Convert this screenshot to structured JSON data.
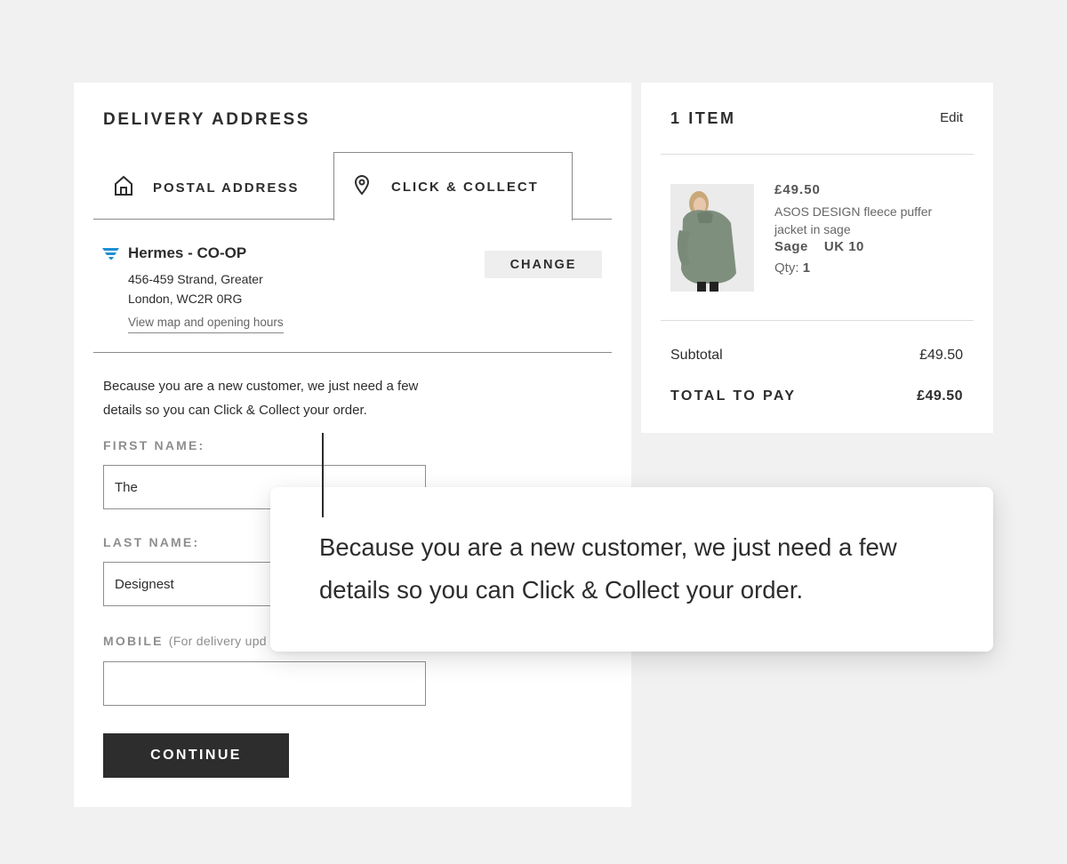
{
  "delivery": {
    "title": "DELIVERY ADDRESS",
    "tabs": {
      "postal": "POSTAL ADDRESS",
      "collect": "CLICK & COLLECT"
    },
    "store": {
      "name": "Hermes - CO-OP",
      "address_line1": "456-459 Strand, Greater",
      "address_line2": "London, WC2R 0RG",
      "map_link": "View map and opening hours",
      "change_label": "CHANGE"
    },
    "intro_line1": "Because you are a new customer, we just need a few",
    "intro_line2": "details so you can Click & Collect your order.",
    "first_name": {
      "label": "FIRST NAME:",
      "value": "The"
    },
    "last_name": {
      "label": "LAST NAME:",
      "value": "Designest"
    },
    "mobile": {
      "label": "MOBILE",
      "note": "(For delivery upd",
      "value": ""
    },
    "continue_label": "CONTINUE"
  },
  "basket": {
    "title": "1 ITEM",
    "edit_label": "Edit",
    "item": {
      "price": "£49.50",
      "name_line1": "ASOS DESIGN fleece puffer",
      "name_line2": "jacket in sage",
      "colour": "Sage",
      "size": "UK 10",
      "qty_label": "Qty:",
      "qty_value": "1"
    },
    "subtotal_label": "Subtotal",
    "subtotal_value": "£49.50",
    "total_label": "TOTAL TO PAY",
    "total_value": "£49.50"
  },
  "callout": {
    "line1": "Because you are a new customer, we just need a few",
    "line2": "details so you can Click & Collect your order."
  },
  "colors": {
    "accent_dark": "#2d2d2d",
    "muted_label": "#8e8e8e",
    "background": "#f1f1f1",
    "hermes_blue": "#1f8fd6"
  },
  "icons": {
    "postal_tab": "home-icon",
    "collect_tab": "location-pin-icon",
    "store_logo": "hermes-logo-icon"
  }
}
